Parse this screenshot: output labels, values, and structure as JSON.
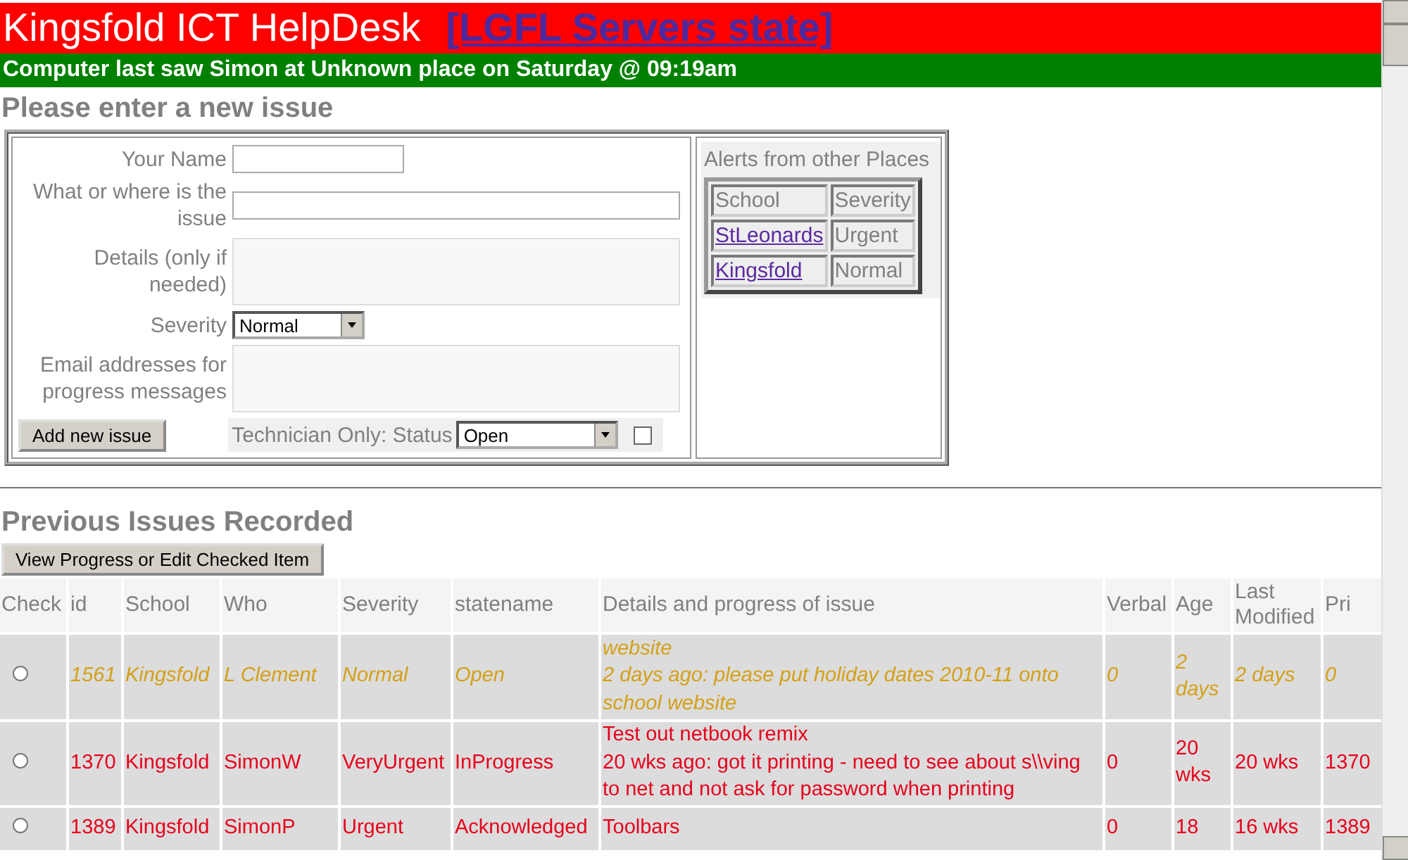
{
  "header": {
    "title": "Kingsfold ICT HelpDesk",
    "link": "[LGFL Servers state]"
  },
  "status_line": "Computer last saw Simon at Unknown place on Saturday @ 09:19am",
  "new_issue": {
    "heading": "Please enter a new issue",
    "fields": [
      {
        "kind": "short_input",
        "label": "Your Name"
      },
      {
        "kind": "long_input",
        "label": "What or where is the issue"
      },
      {
        "kind": "textarea",
        "label": "Details (only if needed)"
      },
      {
        "kind": "select",
        "label": "Severity",
        "value": "Normal"
      },
      {
        "kind": "textarea",
        "label": "Email addresses for progress messages"
      }
    ],
    "submit": "Add new issue",
    "technician": {
      "label": "Technician Only: Status",
      "value": "Open",
      "checked": false
    }
  },
  "alerts": {
    "title": "Alerts from other Places",
    "columns": [
      "School",
      "Severity"
    ],
    "rows": [
      {
        "school": "StLeonards",
        "severity": "Urgent"
      },
      {
        "school": "Kingsfold",
        "severity": "Normal"
      }
    ]
  },
  "previous": {
    "heading": "Previous Issues Recorded",
    "button": "View Progress or Edit Checked Item",
    "columns": [
      "Check",
      "id",
      "School",
      "Who",
      "Severity",
      "statename",
      "Details and progress of issue",
      "Verbal",
      "Age",
      "Last Modified",
      "Pri"
    ],
    "rows": [
      {
        "kind": "normal",
        "selected": false,
        "id": "1561",
        "school": "Kingsfold",
        "who": "L Clement",
        "severity": "Normal",
        "state": "Open",
        "details": [
          "website",
          "2 days ago: please put holiday dates 2010-11 onto school website"
        ],
        "verbal": "0",
        "age": "2 days",
        "modified": "2 days",
        "pri": "0"
      },
      {
        "kind": "urgent",
        "selected": false,
        "id": "1370",
        "school": "Kingsfold",
        "who": "SimonW",
        "severity": "VeryUrgent",
        "state": "InProgress",
        "details": [
          "Test out netbook remix",
          "20 wks ago: got it printing - need to see about s\\\\ving to net and not ask for password when printing"
        ],
        "verbal": "0",
        "age": "20 wks",
        "modified": "20 wks",
        "pri": "1370"
      },
      {
        "kind": "urgent",
        "selected": false,
        "id": "1389",
        "school": "Kingsfold",
        "who": "SimonP",
        "severity": "Urgent",
        "state": "Acknowledged",
        "details": [
          "Toolbars"
        ],
        "verbal": "0",
        "age": "18",
        "modified": "16 wks",
        "pri": "1389"
      }
    ]
  }
}
